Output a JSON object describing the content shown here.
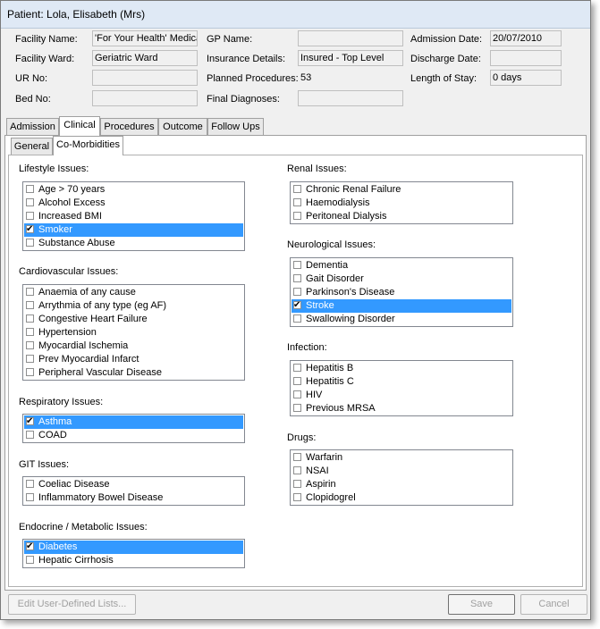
{
  "window": {
    "title": "Patient: Lola, Elisabeth (Mrs)"
  },
  "header": {
    "facility_name": {
      "label": "Facility Name:",
      "value": "'For Your Health' Medical"
    },
    "facility_ward": {
      "label": "Facility Ward:",
      "value": "Geriatric Ward"
    },
    "ur_no": {
      "label": "UR No:",
      "value": ""
    },
    "bed_no": {
      "label": "Bed No:",
      "value": ""
    },
    "gp_name": {
      "label": "GP Name:",
      "value": ""
    },
    "insurance_details": {
      "label": "Insurance Details:",
      "value": "Insured - Top Level"
    },
    "planned_procedures": {
      "label": "Planned Procedures:",
      "value": "53"
    },
    "final_diagnoses": {
      "label": "Final Diagnoses:",
      "value": ""
    },
    "admission_date": {
      "label": "Admission Date:",
      "value": "20/07/2010"
    },
    "discharge_date": {
      "label": "Discharge Date:",
      "value": ""
    },
    "length_of_stay": {
      "label": "Length of Stay:",
      "value": "0 days"
    }
  },
  "tabs": [
    "Admission",
    "Clinical",
    "Procedures",
    "Outcome",
    "Follow Ups"
  ],
  "subtabs": [
    "General",
    "Co-Morbidities"
  ],
  "groups": {
    "lifestyle": {
      "label": "Lifestyle Issues:",
      "items": [
        {
          "text": "Age > 70 years",
          "checked": false,
          "selected": false
        },
        {
          "text": "Alcohol Excess",
          "checked": false,
          "selected": false
        },
        {
          "text": "Increased BMI",
          "checked": false,
          "selected": false
        },
        {
          "text": "Smoker",
          "checked": true,
          "selected": true
        },
        {
          "text": "Substance Abuse",
          "checked": false,
          "selected": false
        }
      ]
    },
    "cardio": {
      "label": "Cardiovascular Issues:",
      "items": [
        {
          "text": "Anaemia of any cause",
          "checked": false,
          "selected": false
        },
        {
          "text": "Arrythmia of any type (eg AF)",
          "checked": false,
          "selected": false
        },
        {
          "text": "Congestive Heart Failure",
          "checked": false,
          "selected": false
        },
        {
          "text": "Hypertension",
          "checked": false,
          "selected": false
        },
        {
          "text": "Myocardial Ischemia",
          "checked": false,
          "selected": false
        },
        {
          "text": "Prev Myocardial Infarct",
          "checked": false,
          "selected": false
        },
        {
          "text": "Peripheral Vascular Disease",
          "checked": false,
          "selected": false
        }
      ]
    },
    "resp": {
      "label": "Respiratory Issues:",
      "items": [
        {
          "text": "Asthma",
          "checked": true,
          "selected": true
        },
        {
          "text": "COAD",
          "checked": false,
          "selected": false
        }
      ]
    },
    "git": {
      "label": "GIT Issues:",
      "items": [
        {
          "text": "Coeliac Disease",
          "checked": false,
          "selected": false
        },
        {
          "text": "Inflammatory Bowel Disease",
          "checked": false,
          "selected": false
        }
      ]
    },
    "endo": {
      "label": "Endocrine / Metabolic Issues:",
      "items": [
        {
          "text": "Diabetes",
          "checked": true,
          "selected": true
        },
        {
          "text": "Hepatic Cirrhosis",
          "checked": false,
          "selected": false
        }
      ]
    },
    "renal": {
      "label": "Renal Issues:",
      "items": [
        {
          "text": "Chronic Renal Failure",
          "checked": false,
          "selected": false
        },
        {
          "text": "Haemodialysis",
          "checked": false,
          "selected": false
        },
        {
          "text": "Peritoneal Dialysis",
          "checked": false,
          "selected": false
        }
      ]
    },
    "neuro": {
      "label": "Neurological Issues:",
      "items": [
        {
          "text": "Dementia",
          "checked": false,
          "selected": false
        },
        {
          "text": "Gait Disorder",
          "checked": false,
          "selected": false
        },
        {
          "text": "Parkinson's Disease",
          "checked": false,
          "selected": false
        },
        {
          "text": "Stroke",
          "checked": true,
          "selected": true
        },
        {
          "text": "Swallowing Disorder",
          "checked": false,
          "selected": false
        }
      ]
    },
    "infection": {
      "label": "Infection:",
      "items": [
        {
          "text": "Hepatitis B",
          "checked": false,
          "selected": false
        },
        {
          "text": "Hepatitis C",
          "checked": false,
          "selected": false
        },
        {
          "text": "HIV",
          "checked": false,
          "selected": false
        },
        {
          "text": "Previous MRSA",
          "checked": false,
          "selected": false
        }
      ]
    },
    "drugs": {
      "label": "Drugs:",
      "items": [
        {
          "text": "Warfarin",
          "checked": false,
          "selected": false
        },
        {
          "text": "NSAI",
          "checked": false,
          "selected": false
        },
        {
          "text": "Aspirin",
          "checked": false,
          "selected": false
        },
        {
          "text": "Clopidogrel",
          "checked": false,
          "selected": false
        }
      ]
    }
  },
  "buttons": {
    "edit_lists": "Edit User-Defined Lists...",
    "save": "Save",
    "cancel": "Cancel"
  },
  "colors": {
    "selection": "#3399ff",
    "titlebar": "#dfe9f5"
  }
}
